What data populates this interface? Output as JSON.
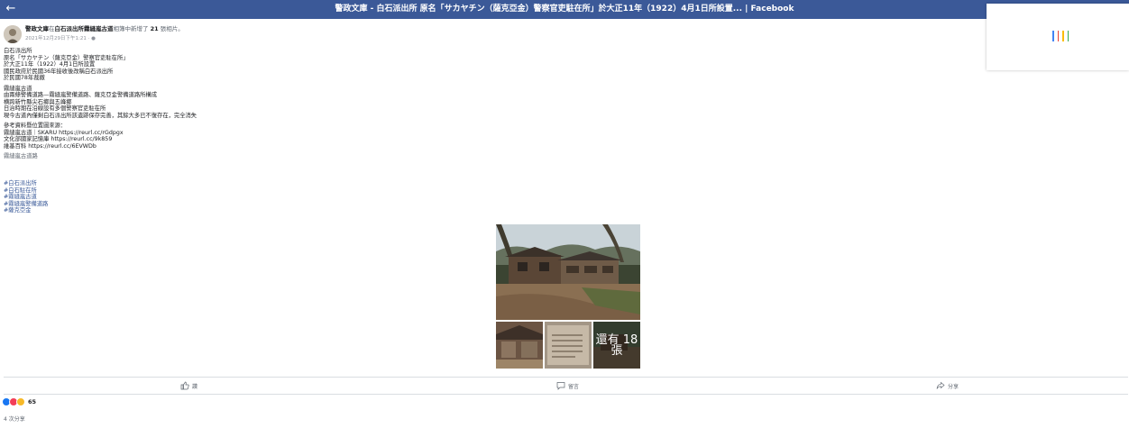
{
  "topbar": {
    "back_icon": "back-arrow-icon",
    "title": "警政文庫 - 白石派出所 原名「サカヤチン（薩克亞金）警察官吏駐在所」於大正11年（1922）4月1日所設置... | Facebook"
  },
  "post": {
    "author": "警政文庫",
    "header_middle": "在",
    "location": "白石派出所霧縫嵐古道",
    "header_suffix": "相簿中新增了",
    "photo_count": "21",
    "header_end": "張相片。",
    "timestamp": "2021年12月29日下午1:21 · ",
    "body_lines_1": [
      "白石派出所",
      "原名「サカヤチン（薩克亞金）警察官吏駐在所」",
      "於大正11年（1922）4月1日所設置",
      "國民政府於民國36年接收後改稱白石派出所",
      "於民國78年裁撤"
    ],
    "body_lines_2": [
      "霧縫嵐古道",
      "由兩條警備道路—霧縫嵐警備道路、薩克亞金警備道路所構成",
      "横跨新竹縣尖石鄉與五峰鄉",
      "日治時期在沿線設有多個警察官吏駐在所",
      "現今古道內僅剩白石派出所該遺跡保存完善，其餘大多已不復存在，完全消失"
    ],
    "body_lines_3": [
      "參考資料暨位置圖來源：",
      "霧縫嵐古道｜SKARU https://reurl.cc/rGdpgx",
      "文化部國家記憶庫 https://reurl.cc/9k859",
      "維基百科 https://reurl.cc/6EVWDb"
    ],
    "body_lines_4": [
      "霧縫嵐古道路"
    ],
    "hashtags": [
      "#白石派出所",
      "#白石駐在所",
      "#霧縫嵐古道",
      "#霧縫嵐警備道路",
      "#薩克亞金"
    ],
    "more_photos": "還有 18 張"
  },
  "actions": {
    "like": "讚",
    "comment": "留言",
    "share": "分享"
  },
  "reactions": {
    "count": "65"
  },
  "shares": "4 次分享",
  "colors": {
    "topbar": "#3b5998",
    "link": "#385898",
    "loader": [
      "#4285f4",
      "#ea4335",
      "#fbbc05",
      "#34a853"
    ]
  }
}
